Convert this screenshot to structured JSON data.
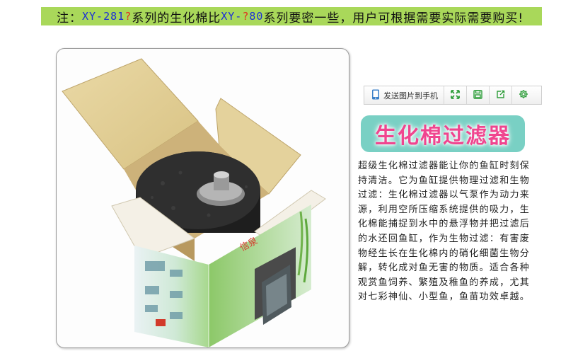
{
  "notice": {
    "prefix": "注：",
    "model_a": "XY-281",
    "q_a": "?",
    "mid": "系列的生化棉比",
    "model_b_pre": "XY-",
    "q_b": "?",
    "model_b_post": "80",
    "suffix": "系列要密一些，用户可根据需要实际需要购买!"
  },
  "toolbar": {
    "send_label": "发送图片到手机",
    "icons": [
      "phone-icon",
      "fullscreen-icon",
      "save-icon",
      "share-icon",
      "settings-icon"
    ]
  },
  "product": {
    "title": "生化棉过滤器",
    "description": "超级生化棉过滤器能让你的鱼缸时刻保持清洁。它为鱼缸提供物理过滤和生物过滤：生化棉过滤器以气泵作为动力来源，利用空所压缩系统提供的吸力，生化棉能捕捉到水中的悬浮物并把过滤后的水还回鱼缸，作为生物过滤：有害废物经生长在生化棉内的硝化细菌生物分解，转化成对鱼无害的物质。适合各种观赏鱼饲养、繁殖及稚鱼的养成，尤其对七彩神仙、小型鱼，鱼苗功效卓越。"
  },
  "colors": {
    "notice_bg": "#a9d85a",
    "model_blue": "#1a2fd6",
    "model_red": "#e0301e",
    "badge_bg": "#79d0c4",
    "badge_text": "#f0458f",
    "icon_green": "#2e9e3a"
  }
}
